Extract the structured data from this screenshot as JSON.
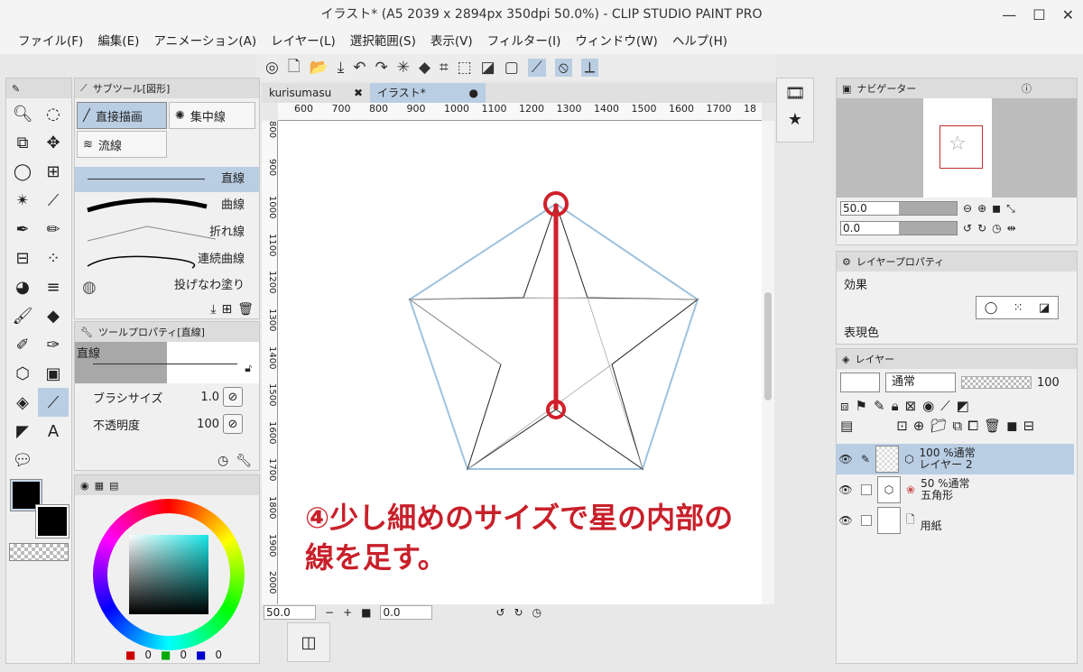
{
  "window": {
    "title": "イラスト* (A5 2039 x 2894px 350dpi 50.0%)  - CLIP STUDIO PAINT PRO",
    "min": "—",
    "max": "☐",
    "close": "✕"
  },
  "menu": [
    "ファイル(F)",
    "編集(E)",
    "アニメーション(A)",
    "レイヤー(L)",
    "選択範囲(S)",
    "表示(V)",
    "フィルター(I)",
    "ウィンドウ(W)",
    "ヘルプ(H)"
  ],
  "subtool": {
    "header": "サブツール[図形]",
    "tab_direct": "直接描画",
    "tab_focus": "集中線",
    "tab_stream": "流線",
    "items": [
      "直線",
      "曲線",
      "折れ線",
      "連続曲線",
      "投げなわ塗り"
    ]
  },
  "toolprop": {
    "header": "ツールプロパティ[直線]",
    "name": "直線",
    "brush_label": "ブラシサイズ",
    "brush_value": "1.0",
    "opacity_label": "不透明度",
    "opacity_value": "100"
  },
  "tabs": {
    "doc1": "kurisumasu",
    "doc2": "イラスト*"
  },
  "ruler_h": [
    "600",
    "700",
    "800",
    "900",
    "1000",
    "1100",
    "1200",
    "1300",
    "1400",
    "1500",
    "1600",
    "1700",
    "18"
  ],
  "ruler_v": [
    "800",
    "900",
    "1000",
    "1100",
    "1200",
    "1300",
    "1400",
    "1500",
    "1600",
    "1700",
    "1800",
    "1900",
    "2000"
  ],
  "status": {
    "zoom": "50.0",
    "angle": "0.0"
  },
  "annotation": {
    "line1": "④少し細めのサイズで星の内部の",
    "line2": "線を足す。"
  },
  "navigator": {
    "header": "ナビゲーター",
    "zoom": "50.0",
    "angle": "0.0"
  },
  "layerprop": {
    "header": "レイヤープロパティ",
    "effect": "効果",
    "expr": "表現色"
  },
  "layers": {
    "header": "レイヤー",
    "blend": "通常",
    "opacity": "100",
    "rows": [
      {
        "mode": "100 %通常",
        "name": "レイヤー 2"
      },
      {
        "mode": "50 %通常",
        "name": "五角形"
      },
      {
        "mode": "",
        "name": "用紙"
      }
    ]
  },
  "color": {
    "r": "0",
    "g": "0",
    "b": "0"
  },
  "colors": {
    "accent": "#b9cde3",
    "annotation": "#c8202a",
    "pentagon": "#9fc2dd",
    "red_line": "#d0202a"
  }
}
